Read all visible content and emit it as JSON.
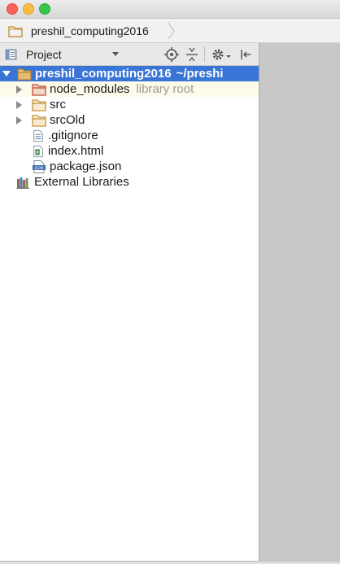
{
  "window": {
    "buttons": [
      "close",
      "minimize",
      "zoom"
    ]
  },
  "breadcrumb": {
    "label": "preshil_computing2016",
    "icon": "folder-icon"
  },
  "tool_window": {
    "view_label": "Project",
    "toolbar_icons": [
      "locate-icon",
      "collapse-all-icon",
      "gear-icon",
      "hide-icon"
    ]
  },
  "tree": {
    "root": {
      "label": "preshil_computing2016",
      "path": "~/preshi"
    },
    "items": [
      {
        "label": "node_modules",
        "hint": "library root",
        "type": "folder"
      },
      {
        "label": "src",
        "type": "folder"
      },
      {
        "label": "srcOld",
        "type": "folder"
      },
      {
        "label": ".gitignore",
        "type": "text-file"
      },
      {
        "label": "index.html",
        "type": "html-file"
      },
      {
        "label": "package.json",
        "type": "json-file"
      }
    ],
    "external": {
      "label": "External Libraries"
    }
  },
  "colors": {
    "selection": "#3875d7",
    "folder": "#d6a55c",
    "library_folder": "#c9564a",
    "editor_bg": "#c8c8c8"
  }
}
